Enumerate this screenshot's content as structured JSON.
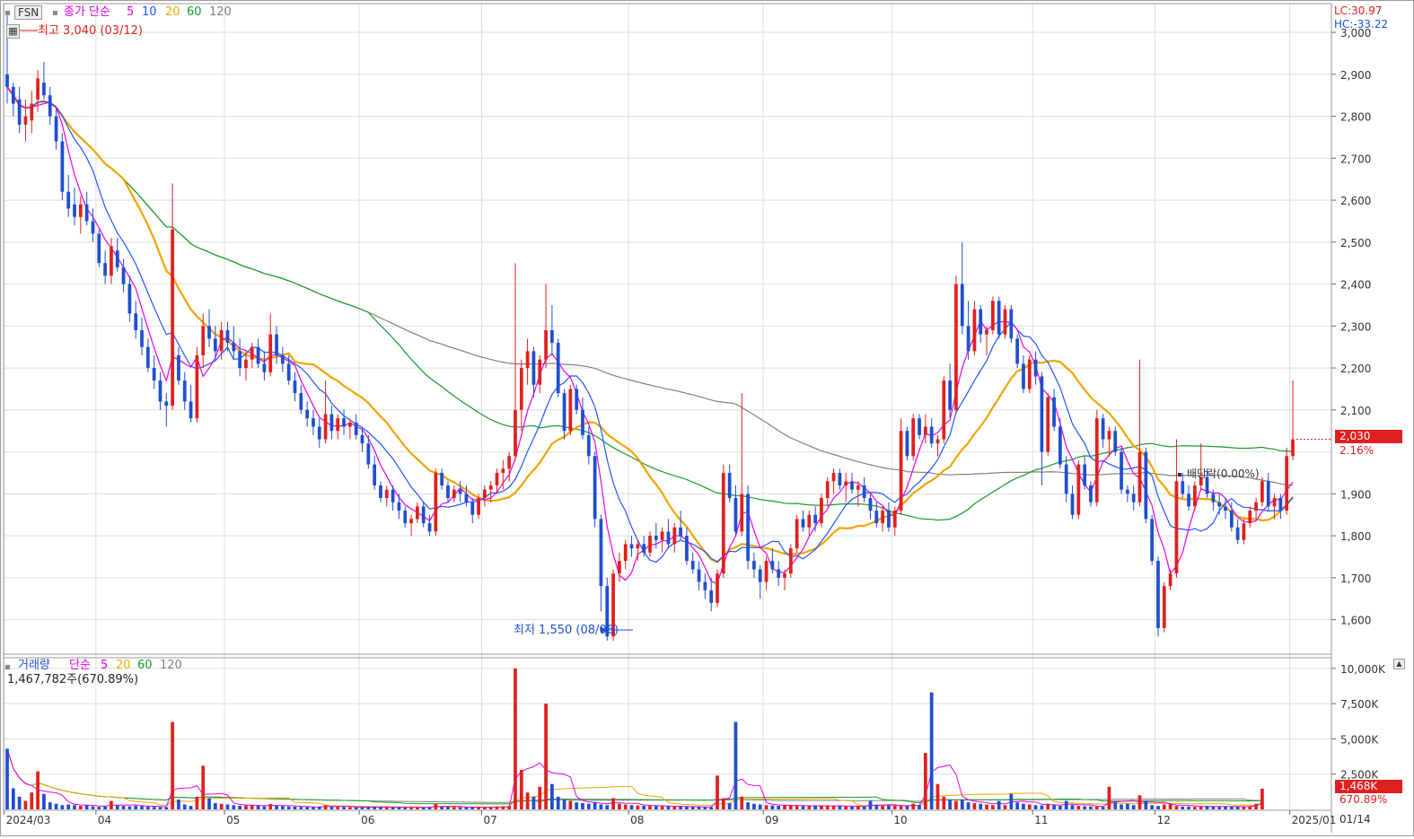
{
  "price_panel": {
    "symbol": "FSN",
    "legend_label": "종가 단순",
    "ma_periods": [
      "5",
      "10",
      "20",
      "60",
      "120"
    ],
    "ma_colors": [
      "#e600e6",
      "#1f55ff",
      "#f0a500",
      "#1a9a2a",
      "#808080"
    ],
    "lc_label": "LC:30.97",
    "hc_label": "HC:-33.22",
    "high_marker": "최고 3,040 (03/12)",
    "low_marker": "최저 1,550 (08/06)",
    "dividend_marker": "배당락(0.00%)",
    "current_price": "2,030",
    "current_change": "2.16%",
    "y_ticks": [
      "3,000",
      "2,900",
      "2,800",
      "2,700",
      "2,600",
      "2,500",
      "2,400",
      "2,300",
      "2,200",
      "2,100",
      "1,900",
      "1,800",
      "1,700",
      "1,600"
    ]
  },
  "volume_panel": {
    "legend_label": "거래량",
    "legend_sub": "단순",
    "ma_periods": [
      "5",
      "20",
      "60",
      "120"
    ],
    "ma_colors": [
      "#e600e6",
      "#f0a500",
      "#1a9a2a",
      "#808080"
    ],
    "info": "1,467,782주(670.89%)",
    "y_ticks": [
      "10,000K",
      "7,500K",
      "5,000K",
      "2,500K"
    ],
    "current_volume": "1,468K",
    "current_ratio": "670.89%"
  },
  "x_axis": {
    "labels": [
      "2024/03",
      "04",
      "05",
      "06",
      "07",
      "08",
      "09",
      "10",
      "11",
      "12",
      "2025/01"
    ],
    "next_date": "01/14"
  },
  "colors": {
    "up": "#e02020",
    "down": "#1f4fd0",
    "grid": "#dedede"
  },
  "chart_data": {
    "type": "candlestick",
    "y_range": [
      1520,
      3060
    ],
    "volume_range_k": [
      0,
      10500
    ],
    "months": [
      "2024/03",
      "04",
      "05",
      "06",
      "07",
      "08",
      "09",
      "10",
      "11",
      "12",
      "2025/01"
    ],
    "month_start_index": [
      0,
      15,
      36,
      58,
      78,
      102,
      124,
      145,
      168,
      188,
      210
    ],
    "ohlc": [
      [
        2900,
        3040,
        2830,
        2870
      ],
      [
        2870,
        2880,
        2800,
        2830
      ],
      [
        2840,
        2870,
        2760,
        2780
      ],
      [
        2780,
        2840,
        2740,
        2800
      ],
      [
        2790,
        2860,
        2760,
        2830
      ],
      [
        2840,
        2910,
        2810,
        2890
      ],
      [
        2880,
        2930,
        2840,
        2850
      ],
      [
        2850,
        2870,
        2780,
        2800
      ],
      [
        2800,
        2820,
        2720,
        2740
      ],
      [
        2740,
        2760,
        2600,
        2620
      ],
      [
        2620,
        2660,
        2560,
        2580
      ],
      [
        2590,
        2630,
        2540,
        2560
      ],
      [
        2560,
        2610,
        2520,
        2590
      ],
      [
        2590,
        2620,
        2540,
        2550
      ],
      [
        2550,
        2580,
        2500,
        2520
      ],
      [
        2520,
        2530,
        2440,
        2450
      ],
      [
        2450,
        2480,
        2400,
        2420
      ],
      [
        2420,
        2510,
        2400,
        2490
      ],
      [
        2480,
        2510,
        2430,
        2440
      ],
      [
        2440,
        2460,
        2380,
        2400
      ],
      [
        2400,
        2420,
        2310,
        2330
      ],
      [
        2330,
        2360,
        2270,
        2290
      ],
      [
        2290,
        2320,
        2230,
        2250
      ],
      [
        2250,
        2270,
        2190,
        2200
      ],
      [
        2200,
        2230,
        2150,
        2170
      ],
      [
        2170,
        2190,
        2100,
        2120
      ],
      [
        2120,
        2140,
        2060,
        2110
      ],
      [
        2110,
        2640,
        2100,
        2530
      ],
      [
        2230,
        2250,
        2160,
        2170
      ],
      [
        2170,
        2190,
        2100,
        2120
      ],
      [
        2120,
        2160,
        2070,
        2080
      ],
      [
        2080,
        2250,
        2070,
        2230
      ],
      [
        2230,
        2330,
        2200,
        2300
      ],
      [
        2300,
        2340,
        2250,
        2270
      ],
      [
        2270,
        2300,
        2220,
        2240
      ],
      [
        2240,
        2310,
        2220,
        2290
      ],
      [
        2290,
        2310,
        2240,
        2260
      ],
      [
        2260,
        2300,
        2220,
        2240
      ],
      [
        2240,
        2270,
        2180,
        2200
      ],
      [
        2200,
        2240,
        2170,
        2220
      ],
      [
        2220,
        2260,
        2200,
        2250
      ],
      [
        2250,
        2270,
        2200,
        2210
      ],
      [
        2210,
        2240,
        2170,
        2190
      ],
      [
        2190,
        2330,
        2180,
        2280
      ],
      [
        2280,
        2300,
        2210,
        2230
      ],
      [
        2230,
        2250,
        2190,
        2210
      ],
      [
        2210,
        2230,
        2160,
        2170
      ],
      [
        2170,
        2190,
        2120,
        2140
      ],
      [
        2140,
        2160,
        2090,
        2100
      ],
      [
        2100,
        2120,
        2060,
        2080
      ],
      [
        2080,
        2100,
        2040,
        2060
      ],
      [
        2060,
        2080,
        2010,
        2030
      ],
      [
        2030,
        2170,
        2020,
        2090
      ],
      [
        2090,
        2110,
        2030,
        2050
      ],
      [
        2050,
        2090,
        2030,
        2080
      ],
      [
        2080,
        2100,
        2040,
        2060
      ],
      [
        2060,
        2080,
        2030,
        2070
      ],
      [
        2070,
        2090,
        2030,
        2040
      ],
      [
        2040,
        2060,
        2000,
        2020
      ],
      [
        2020,
        2040,
        1960,
        1970
      ],
      [
        1970,
        1990,
        1910,
        1920
      ],
      [
        1920,
        1930,
        1880,
        1890
      ],
      [
        1890,
        1920,
        1870,
        1910
      ],
      [
        1910,
        1920,
        1860,
        1880
      ],
      [
        1880,
        1900,
        1840,
        1860
      ],
      [
        1860,
        1870,
        1820,
        1830
      ],
      [
        1830,
        1850,
        1800,
        1840
      ],
      [
        1840,
        1880,
        1830,
        1870
      ],
      [
        1870,
        1880,
        1820,
        1830
      ],
      [
        1830,
        1850,
        1800,
        1810
      ],
      [
        1810,
        1960,
        1800,
        1950
      ],
      [
        1950,
        1960,
        1910,
        1920
      ],
      [
        1920,
        1930,
        1880,
        1890
      ],
      [
        1890,
        1920,
        1880,
        1910
      ],
      [
        1910,
        1930,
        1880,
        1900
      ],
      [
        1900,
        1920,
        1870,
        1880
      ],
      [
        1880,
        1890,
        1830,
        1850
      ],
      [
        1850,
        1900,
        1840,
        1890
      ],
      [
        1890,
        1920,
        1870,
        1910
      ],
      [
        1910,
        1930,
        1880,
        1920
      ],
      [
        1920,
        1960,
        1900,
        1950
      ],
      [
        1950,
        1980,
        1910,
        1960
      ],
      [
        1960,
        2000,
        1930,
        1990
      ],
      [
        1990,
        2450,
        1980,
        2100
      ],
      [
        2100,
        2220,
        2050,
        2200
      ],
      [
        2200,
        2270,
        2160,
        2240
      ],
      [
        2240,
        2250,
        2130,
        2160
      ],
      [
        2160,
        2230,
        2140,
        2220
      ],
      [
        2220,
        2400,
        2200,
        2290
      ],
      [
        2290,
        2350,
        2230,
        2260
      ],
      [
        2260,
        2270,
        2130,
        2140
      ],
      [
        2140,
        2150,
        2030,
        2050
      ],
      [
        2050,
        2160,
        2040,
        2150
      ],
      [
        2150,
        2160,
        2090,
        2100
      ],
      [
        2100,
        2130,
        2030,
        2040
      ],
      [
        2040,
        2060,
        1970,
        1990
      ],
      [
        1990,
        2000,
        1820,
        1840
      ],
      [
        1840,
        1850,
        1620,
        1680
      ],
      [
        1680,
        1700,
        1550,
        1560
      ],
      [
        1560,
        1720,
        1550,
        1710
      ],
      [
        1710,
        1760,
        1690,
        1740
      ],
      [
        1740,
        1790,
        1720,
        1780
      ],
      [
        1780,
        1800,
        1750,
        1770
      ],
      [
        1770,
        1790,
        1740,
        1780
      ],
      [
        1780,
        1800,
        1750,
        1760
      ],
      [
        1760,
        1810,
        1750,
        1800
      ],
      [
        1800,
        1830,
        1770,
        1790
      ],
      [
        1790,
        1820,
        1760,
        1810
      ],
      [
        1810,
        1840,
        1770,
        1780
      ],
      [
        1780,
        1830,
        1760,
        1820
      ],
      [
        1820,
        1860,
        1790,
        1800
      ],
      [
        1800,
        1820,
        1730,
        1740
      ],
      [
        1740,
        1760,
        1710,
        1720
      ],
      [
        1720,
        1740,
        1670,
        1690
      ],
      [
        1690,
        1710,
        1650,
        1670
      ],
      [
        1670,
        1700,
        1620,
        1640
      ],
      [
        1640,
        1720,
        1630,
        1710
      ],
      [
        1710,
        1970,
        1700,
        1950
      ],
      [
        1950,
        1970,
        1880,
        1890
      ],
      [
        1890,
        1920,
        1800,
        1810
      ],
      [
        1810,
        2140,
        1800,
        1900
      ],
      [
        1900,
        1920,
        1720,
        1740
      ],
      [
        1740,
        1760,
        1700,
        1720
      ],
      [
        1720,
        1730,
        1650,
        1690
      ],
      [
        1690,
        1750,
        1670,
        1740
      ],
      [
        1740,
        1770,
        1710,
        1720
      ],
      [
        1720,
        1740,
        1680,
        1700
      ],
      [
        1700,
        1720,
        1670,
        1710
      ],
      [
        1710,
        1780,
        1700,
        1770
      ],
      [
        1770,
        1850,
        1760,
        1840
      ],
      [
        1840,
        1860,
        1810,
        1820
      ],
      [
        1820,
        1860,
        1800,
        1850
      ],
      [
        1850,
        1870,
        1810,
        1830
      ],
      [
        1830,
        1900,
        1820,
        1890
      ],
      [
        1890,
        1940,
        1870,
        1930
      ],
      [
        1930,
        1960,
        1900,
        1950
      ],
      [
        1950,
        1960,
        1910,
        1920
      ],
      [
        1920,
        1950,
        1880,
        1930
      ],
      [
        1930,
        1950,
        1900,
        1910
      ],
      [
        1910,
        1930,
        1870,
        1920
      ],
      [
        1920,
        1940,
        1880,
        1890
      ],
      [
        1890,
        1900,
        1840,
        1860
      ],
      [
        1860,
        1880,
        1820,
        1830
      ],
      [
        1830,
        1870,
        1810,
        1860
      ],
      [
        1860,
        1880,
        1810,
        1820
      ],
      [
        1820,
        1870,
        1800,
        1860
      ],
      [
        1860,
        2080,
        1850,
        2050
      ],
      [
        2050,
        2060,
        1980,
        1990
      ],
      [
        1990,
        2090,
        1980,
        2080
      ],
      [
        2080,
        2090,
        2030,
        2040
      ],
      [
        2040,
        2090,
        2020,
        2060
      ],
      [
        2060,
        2080,
        2010,
        2020
      ],
      [
        2020,
        2040,
        1990,
        2030
      ],
      [
        2030,
        2180,
        2020,
        2170
      ],
      [
        2170,
        2210,
        2080,
        2100
      ],
      [
        2100,
        2420,
        2090,
        2400
      ],
      [
        2400,
        2500,
        2280,
        2300
      ],
      [
        2300,
        2360,
        2220,
        2240
      ],
      [
        2240,
        2360,
        2230,
        2340
      ],
      [
        2340,
        2350,
        2260,
        2280
      ],
      [
        2280,
        2300,
        2230,
        2290
      ],
      [
        2290,
        2370,
        2280,
        2360
      ],
      [
        2360,
        2370,
        2270,
        2280
      ],
      [
        2280,
        2350,
        2270,
        2340
      ],
      [
        2340,
        2350,
        2260,
        2270
      ],
      [
        2270,
        2280,
        2200,
        2210
      ],
      [
        2210,
        2230,
        2140,
        2150
      ],
      [
        2150,
        2230,
        2140,
        2220
      ],
      [
        2220,
        2240,
        2160,
        2180
      ],
      [
        2180,
        2190,
        1920,
        2000
      ],
      [
        2000,
        2140,
        1990,
        2130
      ],
      [
        2130,
        2150,
        2050,
        2060
      ],
      [
        2060,
        2080,
        1960,
        1970
      ],
      [
        1970,
        1990,
        1880,
        1900
      ],
      [
        1900,
        1920,
        1840,
        1850
      ],
      [
        1850,
        1980,
        1840,
        1970
      ],
      [
        1970,
        1990,
        1910,
        1920
      ],
      [
        1920,
        1930,
        1870,
        1880
      ],
      [
        1880,
        2100,
        1870,
        2080
      ],
      [
        2080,
        2090,
        2010,
        2030
      ],
      [
        2030,
        2060,
        1990,
        2050
      ],
      [
        2050,
        2060,
        1990,
        2000
      ],
      [
        2000,
        2010,
        1900,
        1910
      ],
      [
        1910,
        1920,
        1880,
        1900
      ],
      [
        1900,
        1920,
        1860,
        1880
      ],
      [
        1880,
        2220,
        1870,
        2000
      ],
      [
        2000,
        2010,
        1830,
        1840
      ],
      [
        1840,
        1850,
        1730,
        1740
      ],
      [
        1740,
        1750,
        1560,
        1580
      ],
      [
        1580,
        1690,
        1570,
        1680
      ],
      [
        1680,
        1720,
        1670,
        1710
      ],
      [
        1710,
        2030,
        1700,
        1930
      ],
      [
        1930,
        1950,
        1890,
        1900
      ],
      [
        1900,
        1920,
        1860,
        1870
      ],
      [
        1870,
        1930,
        1860,
        1920
      ],
      [
        1920,
        2020,
        1910,
        1940
      ],
      [
        1940,
        1960,
        1890,
        1900
      ],
      [
        1900,
        1910,
        1860,
        1880
      ],
      [
        1880,
        1900,
        1850,
        1870
      ],
      [
        1870,
        1890,
        1840,
        1860
      ],
      [
        1860,
        1880,
        1810,
        1820
      ],
      [
        1820,
        1840,
        1780,
        1790
      ],
      [
        1790,
        1840,
        1780,
        1830
      ],
      [
        1830,
        1870,
        1820,
        1860
      ],
      [
        1860,
        1890,
        1840,
        1880
      ],
      [
        1880,
        1940,
        1870,
        1930
      ],
      [
        1930,
        1950,
        1860,
        1870
      ],
      [
        1870,
        1900,
        1840,
        1890
      ],
      [
        1890,
        1900,
        1840,
        1860
      ],
      [
        1860,
        2010,
        1850,
        1990
      ],
      [
        1990,
        2170,
        1980,
        2030
      ]
    ],
    "volume_k": [
      4300,
      1500,
      900,
      600,
      1200,
      2700,
      1100,
      500,
      400,
      300,
      350,
      300,
      250,
      300,
      220,
      180,
      200,
      600,
      300,
      250,
      220,
      260,
      240,
      200,
      180,
      160,
      150,
      6200,
      700,
      350,
      250,
      900,
      3100,
      800,
      450,
      400,
      350,
      300,
      260,
      280,
      300,
      250,
      220,
      380,
      260,
      240,
      200,
      190,
      180,
      170,
      160,
      170,
      300,
      200,
      180,
      170,
      160,
      150,
      150,
      160,
      170,
      160,
      150,
      150,
      140,
      140,
      150,
      160,
      150,
      150,
      400,
      200,
      180,
      160,
      150,
      150,
      140,
      160,
      150,
      160,
      200,
      220,
      240,
      10000,
      2800,
      1200,
      900,
      1600,
      7500,
      1800,
      900,
      700,
      600,
      500,
      450,
      400,
      500,
      350,
      300,
      800,
      400,
      350,
      300,
      280,
      260,
      250,
      240,
      230,
      220,
      210,
      200,
      190,
      180,
      170,
      160,
      160,
      2400,
      800,
      450,
      6200,
      900,
      500,
      400,
      350,
      300,
      280,
      260,
      300,
      300,
      250,
      240,
      230,
      260,
      280,
      250,
      240,
      230,
      220,
      210,
      200,
      200,
      600,
      300,
      250,
      280,
      260,
      240,
      230,
      400,
      300,
      4000,
      8300,
      1800,
      900,
      700,
      600,
      700,
      500,
      450,
      400,
      350,
      300,
      600,
      300,
      1100,
      500,
      400,
      350,
      300,
      280,
      400,
      300,
      250,
      600,
      300,
      250,
      220,
      200,
      190,
      180,
      1600,
      500,
      350,
      400,
      300,
      1000,
      600,
      300,
      250,
      350,
      400,
      250,
      200,
      200,
      180,
      200,
      250,
      200,
      180,
      200,
      220,
      200,
      190,
      220,
      400,
      1468
    ],
    "ma_values_note": "moving averages computed from closes"
  }
}
